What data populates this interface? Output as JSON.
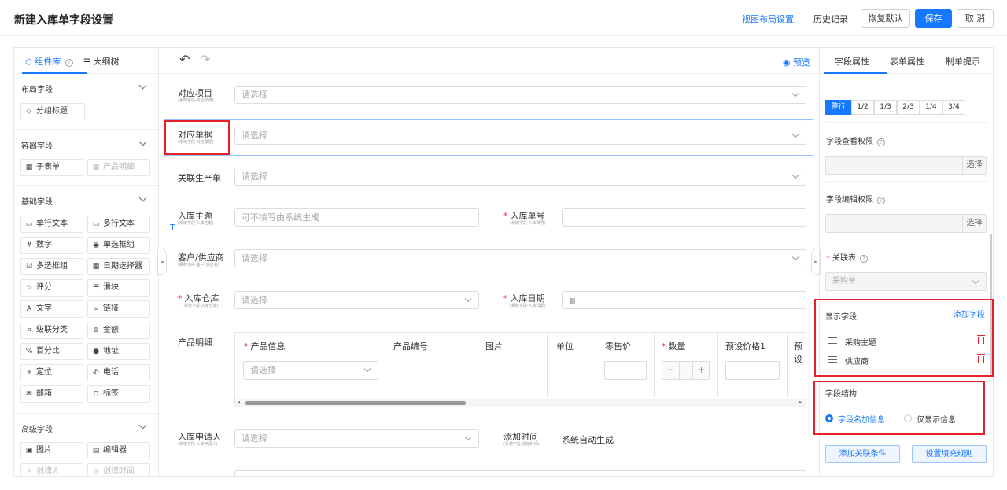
{
  "header": {
    "title": "新建入库单字段设置",
    "view_layout": "视图布局设置",
    "history": "历史记录",
    "restore_default": "恢复默认",
    "save": "保存",
    "cancel": "取 消"
  },
  "left_panel": {
    "tabs": [
      "组件库",
      "大纲树"
    ],
    "sections": {
      "layout": {
        "title": "布局字段",
        "items": [
          "分组标题"
        ]
      },
      "container": {
        "title": "容器字段",
        "items": [
          "子表单",
          "产品明细"
        ]
      },
      "basic": {
        "title": "基础字段",
        "items": [
          "单行文本",
          "多行文本",
          "数字",
          "单选框组",
          "多选框组",
          "日期选择器",
          "评分",
          "滑块",
          "文字",
          "链接",
          "级联分类",
          "金额",
          "百分比",
          "地址",
          "定位",
          "电话",
          "邮箱",
          "标签"
        ]
      },
      "advanced": {
        "title": "高级字段",
        "items": [
          "图片",
          "编辑器",
          "创建人",
          "创建时间"
        ]
      }
    }
  },
  "center": {
    "preview": "预览",
    "placeholder_select": "请选择",
    "fields": {
      "project": {
        "label": "对应项目",
        "sub": "(系统字段-对应项目)"
      },
      "document": {
        "label": "对应单据",
        "sub": "(系统字段-对应单据)"
      },
      "production": {
        "label": "关联生产单"
      },
      "subject": {
        "label": "入库主题",
        "sub": "(系统字段-入库主题)",
        "placeholder": "可不填写由系统生成"
      },
      "number": {
        "label": "入库单号",
        "sub": "(系统字段-入库单号)"
      },
      "customer": {
        "label": "客户/供应商",
        "sub": "(系统字段-客户/供应商)"
      },
      "warehouse": {
        "label": "入库仓库",
        "sub": "(系统字段-入库仓库)"
      },
      "date": {
        "label": "入库日期",
        "sub": "(系统字段-入库日期)"
      },
      "products": {
        "label": "产品明细"
      },
      "applicant": {
        "label": "入库申请人",
        "sub": "(系统字段-入库申请人)"
      },
      "add_time": {
        "label": "添加时间",
        "sub": "(系统字段-添加时间)",
        "value": "系统自动生成"
      }
    },
    "table": {
      "columns": [
        "产品信息",
        "产品编号",
        "图片",
        "单位",
        "零售价",
        "数量",
        "预设价格1",
        "预设"
      ],
      "row_placeholder": "请选择"
    }
  },
  "right_panel": {
    "tabs": [
      "字段属性",
      "表单属性",
      "制单提示"
    ],
    "width_options": [
      "整行",
      "1/2",
      "1/3",
      "2/3",
      "1/4",
      "3/4"
    ],
    "view_permission": "字段查看权限",
    "edit_permission": "字段编辑权限",
    "choose": "选择",
    "related_table": {
      "label": "关联表",
      "value": "采购单"
    },
    "display_fields": {
      "title": "显示字段",
      "add": "添加字段",
      "items": [
        "采购主题",
        "供应商"
      ]
    },
    "structure": {
      "title": "字段结构",
      "options": [
        "字段名加信息",
        "仅显示信息"
      ]
    },
    "add_condition": "添加关联条件",
    "fill_rule": "设置填充规则"
  },
  "colors": {
    "primary": "#1677ff",
    "highlight": "#e8202a"
  }
}
